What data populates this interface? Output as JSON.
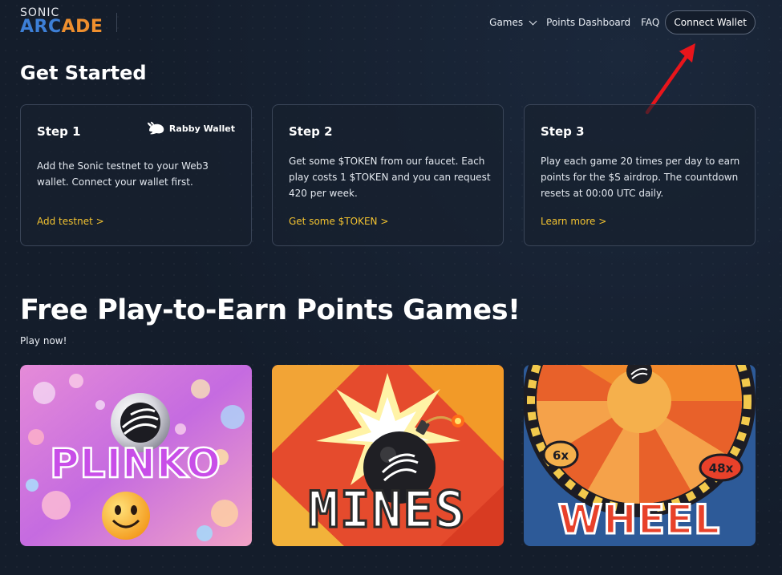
{
  "header": {
    "logo_top": "SONIC",
    "logo_bottom_1": "ARC",
    "logo_bottom_2": "ADE",
    "nav": {
      "games": "Games",
      "points_dashboard": "Points Dashboard",
      "faq": "FAQ",
      "connect_wallet": "Connect Wallet"
    }
  },
  "get_started": {
    "heading": "Get Started",
    "steps": [
      {
        "title": "Step 1",
        "badge": "Rabby Wallet",
        "description": "Add the Sonic testnet to your Web3 wallet. Connect your wallet first.",
        "link": "Add testnet >"
      },
      {
        "title": "Step 2",
        "description": "Get some $TOKEN from our faucet. Each play costs 1 $TOKEN and you can request 420 per week.",
        "link": "Get some $TOKEN >"
      },
      {
        "title": "Step 3",
        "description": "Play each game 20 times per day to earn points for the $S airdrop. The countdown resets at 00:00 UTC daily.",
        "link": "Learn more >"
      }
    ]
  },
  "games": {
    "heading": "Free Play-to-Earn Points Games!",
    "subheading": "Play now!",
    "cards": [
      {
        "title": "PLINKO"
      },
      {
        "title": "MINES"
      },
      {
        "title": "WHEEL",
        "multipliers": [
          "6x",
          "48x"
        ]
      }
    ]
  },
  "colors": {
    "background": "#141d2b",
    "accent_link": "#f2c230",
    "logo_blue": "#3d7fd6",
    "logo_orange": "#ef8f2e",
    "annotation_arrow": "#e8151b"
  }
}
